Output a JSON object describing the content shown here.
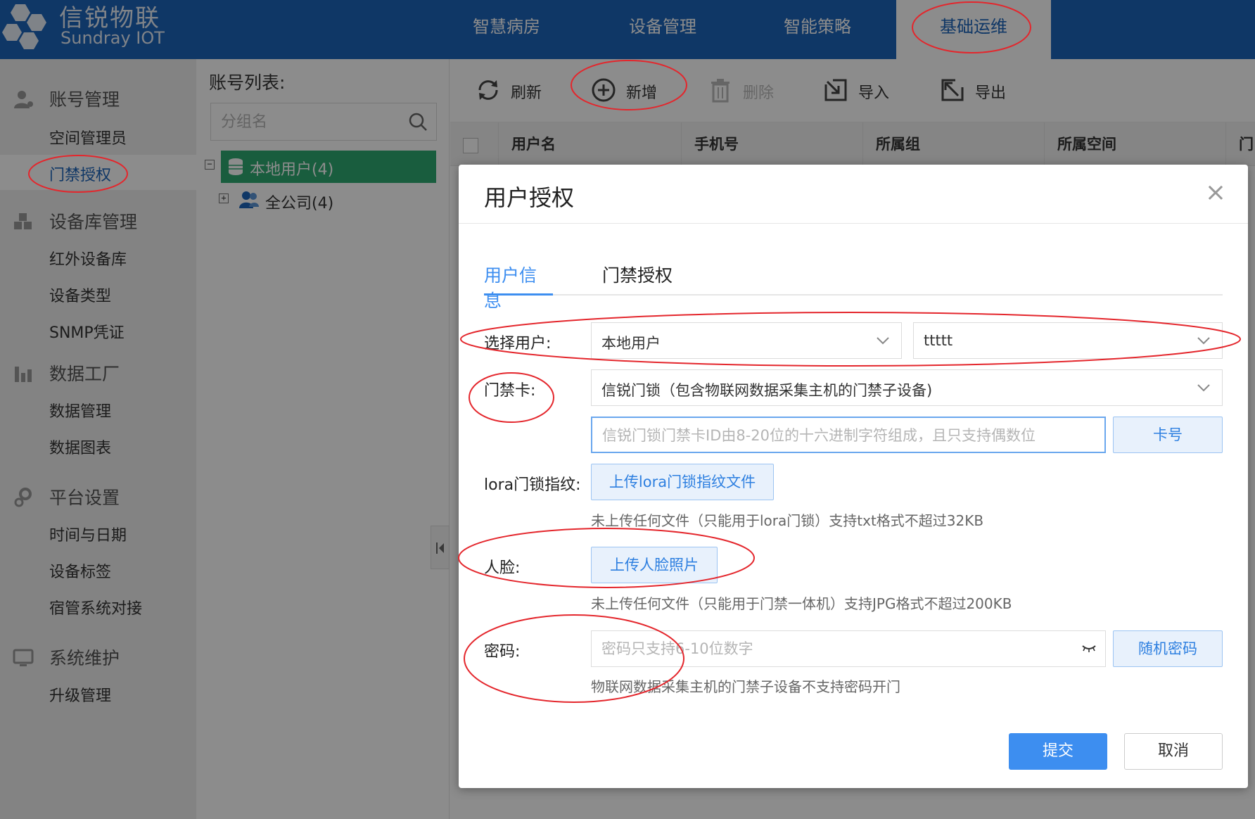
{
  "colors": {
    "brand_blue": "#1d64bb",
    "accent_blue": "#3d8ef0",
    "tree_selected": "#2eaa72",
    "annotation_red": "#e4262c"
  },
  "header": {
    "logo_cn": "信锐物联",
    "logo_en": "Sundray IOT",
    "nav": [
      {
        "label": "智慧病房"
      },
      {
        "label": "设备管理"
      },
      {
        "label": "智能策略"
      },
      {
        "label": "基础运维"
      }
    ]
  },
  "sidebar": {
    "groups": [
      {
        "label": "账号管理",
        "icon": "user-icon",
        "items": [
          {
            "label": "空间管理员"
          },
          {
            "label": "门禁授权"
          }
        ]
      },
      {
        "label": "设备库管理",
        "icon": "cubes-icon",
        "items": [
          {
            "label": "红外设备库"
          },
          {
            "label": "设备类型"
          },
          {
            "label": "SNMP凭证"
          }
        ]
      },
      {
        "label": "数据工厂",
        "icon": "chart-icon",
        "items": [
          {
            "label": "数据管理"
          },
          {
            "label": "数据图表"
          }
        ]
      },
      {
        "label": "平台设置",
        "icon": "gears-icon",
        "items": [
          {
            "label": "时间与日期"
          },
          {
            "label": "设备标签"
          },
          {
            "label": "宿管系统对接"
          }
        ]
      },
      {
        "label": "系统维护",
        "icon": "monitor-icon",
        "items": [
          {
            "label": "升级管理"
          }
        ]
      }
    ]
  },
  "account_list": {
    "title": "账号列表:",
    "search_placeholder": "分组名",
    "tree": [
      {
        "label": "本地用户(4)",
        "toggle": "−"
      },
      {
        "label": "全公司(4)",
        "toggle": "+"
      }
    ]
  },
  "toolbar": {
    "refresh": "刷新",
    "add": "新增",
    "delete": "删除",
    "import": "导入",
    "export": "导出"
  },
  "table": {
    "columns": [
      "用户名",
      "手机号",
      "所属组",
      "所属空间",
      "门禁"
    ]
  },
  "modal": {
    "title": "用户授权",
    "close": "×",
    "tabs": [
      {
        "label": "用户信息"
      },
      {
        "label": "门禁授权"
      }
    ],
    "select_user_label": "选择用户:",
    "user_source": "本地用户",
    "user_name": "ttttt",
    "door_card_label": "门禁卡:",
    "door_card_type": "信锐门锁（包含物联网数据采集主机的门禁子设备)",
    "card_id_placeholder": "信锐门锁门禁卡ID由8-20位的十六进制字符组成，且只支持偶数位",
    "card_button": "卡号",
    "lora_label": "lora门锁指纹:",
    "lora_button": "上传lora门锁指纹文件",
    "lora_hint": "未上传任何文件（只能用于lora门锁）支持txt格式不超过32KB",
    "face_label": "人脸:",
    "face_button": "上传人脸照片",
    "face_hint": "未上传任何文件（只能用于门禁一体机）支持JPG格式不超过200KB",
    "password_label": "密码:",
    "password_placeholder": "密码只支持6-10位数字",
    "random_password_button": "随机密码",
    "password_hint": "物联网数据采集主机的门禁子设备不支持密码开门",
    "submit": "提交",
    "cancel": "取消"
  }
}
